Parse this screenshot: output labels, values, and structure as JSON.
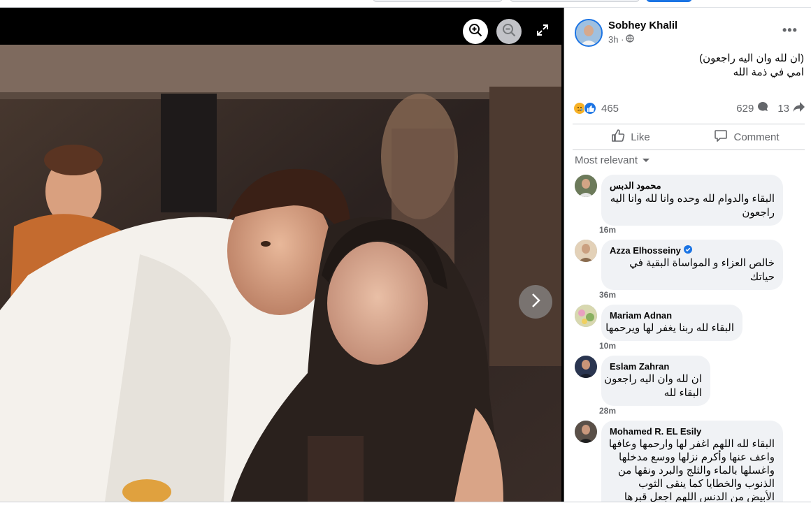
{
  "post": {
    "author": "Sobhey Khalil",
    "time": "3h ·",
    "text_lines": [
      "(ان لله وان اليه راجعون)",
      "امي في ذمة الله"
    ],
    "reactions_count": "465",
    "comments_count": "629",
    "shares_count": "13",
    "like_label": "Like",
    "comment_label": "Comment",
    "sort_label": "Most relevant"
  },
  "viewer": {
    "zoom_in_icon": "zoom-in-icon",
    "zoom_out_icon": "zoom-out-icon",
    "fullscreen_icon": "expand-icon",
    "next_icon": "chevron-right-icon"
  },
  "comments": [
    {
      "name": "محمود الدبس",
      "verified": false,
      "lines": [
        "البقاء والدوام لله وحده وانا لله وانا اليه",
        "راجعون"
      ],
      "time": "16m"
    },
    {
      "name": "Azza Elhosseiny",
      "verified": true,
      "lines": [
        "خالص العزاء و المواساة البقية في",
        "حياتك"
      ],
      "time": "36m"
    },
    {
      "name": "Mariam Adnan",
      "verified": false,
      "lines": [
        "البقاء لله ربنا يغفر لها ويرحمها"
      ],
      "time": "10m"
    },
    {
      "name": "Eslam Zahran",
      "verified": false,
      "lines": [
        "ان لله وان اليه راجعون",
        "البقاء لله"
      ],
      "time": "28m"
    },
    {
      "name": "Mohamed R. EL Esily",
      "verified": false,
      "lines": [
        "البقاء لله اللهم اغفر لها وارحمها وعافها",
        "واعف عنها وأكرم نزلها ووسع مدخلها",
        "واغسلها بالماء والثلج والبرد ونقها من",
        "الذنوب والخطايا كما ينقى الثوب",
        "الأبيض من الدنس اللهم اجعل قبرها"
      ],
      "time": ""
    }
  ],
  "colors": {
    "accent": "#1b74e4",
    "bubble": "#f0f2f5",
    "secondary_text": "#65676b"
  }
}
